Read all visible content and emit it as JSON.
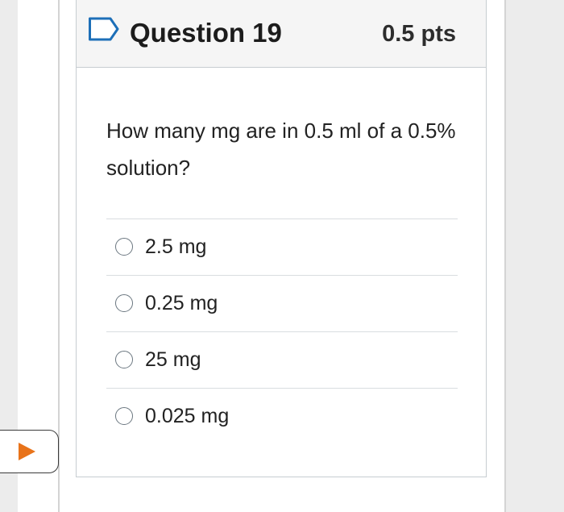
{
  "question": {
    "title": "Question 19",
    "points": "0.5 pts",
    "text": "How many mg are in 0.5 ml of a 0.5% solution?",
    "flag_icon": "flag-bookmark-icon",
    "flag_color": "#1d6fb8"
  },
  "answers": [
    {
      "label": "2.5 mg",
      "selected": false
    },
    {
      "label": "0.25 mg",
      "selected": false
    },
    {
      "label": "25 mg",
      "selected": false
    },
    {
      "label": "0.025 mg",
      "selected": false
    }
  ],
  "nav_tab": {
    "icon": "play-icon",
    "icon_color": "#e8731a"
  }
}
